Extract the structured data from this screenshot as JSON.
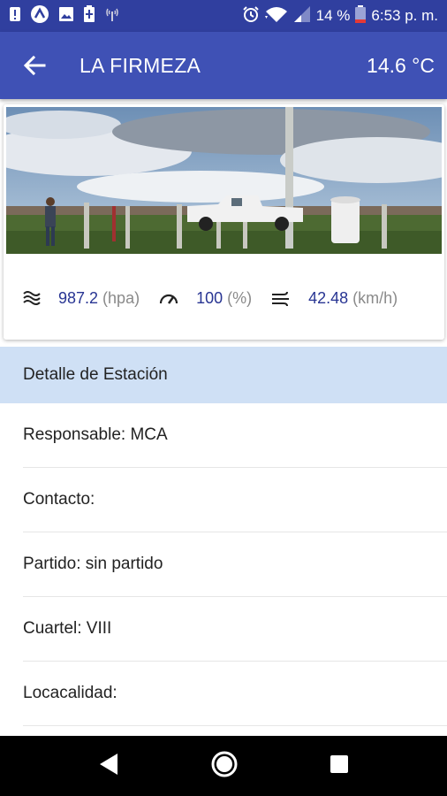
{
  "status_bar": {
    "battery_percent": "14 %",
    "time": "6:53 p. m.",
    "icons": [
      "alert-icon",
      "account-icon",
      "image-icon",
      "battery-charging-icon",
      "antenna-icon",
      "alarm-icon",
      "wifi-icon",
      "signal-icon",
      "battery-icon"
    ]
  },
  "app_bar": {
    "title": "LA FIRMEZA",
    "temperature": "14.6 °C"
  },
  "metrics": [
    {
      "icon": "pressure-icon",
      "value": "987.2",
      "unit": "(hpa)"
    },
    {
      "icon": "gauge-icon",
      "value": "100",
      "unit": "(%)"
    },
    {
      "icon": "wind-icon",
      "value": "42.48",
      "unit": "(km/h)"
    }
  ],
  "section": {
    "title": "Detalle de Estación"
  },
  "details": [
    "Responsable: MCA",
    "Contacto:",
    "Partido: sin partido",
    "Cuartel: VIII",
    "Locacalidad:"
  ],
  "colors": {
    "status_bar": "#303f9f",
    "app_bar": "#3f51b5",
    "value_text": "#283593",
    "section_bg": "#cfe0f5"
  }
}
